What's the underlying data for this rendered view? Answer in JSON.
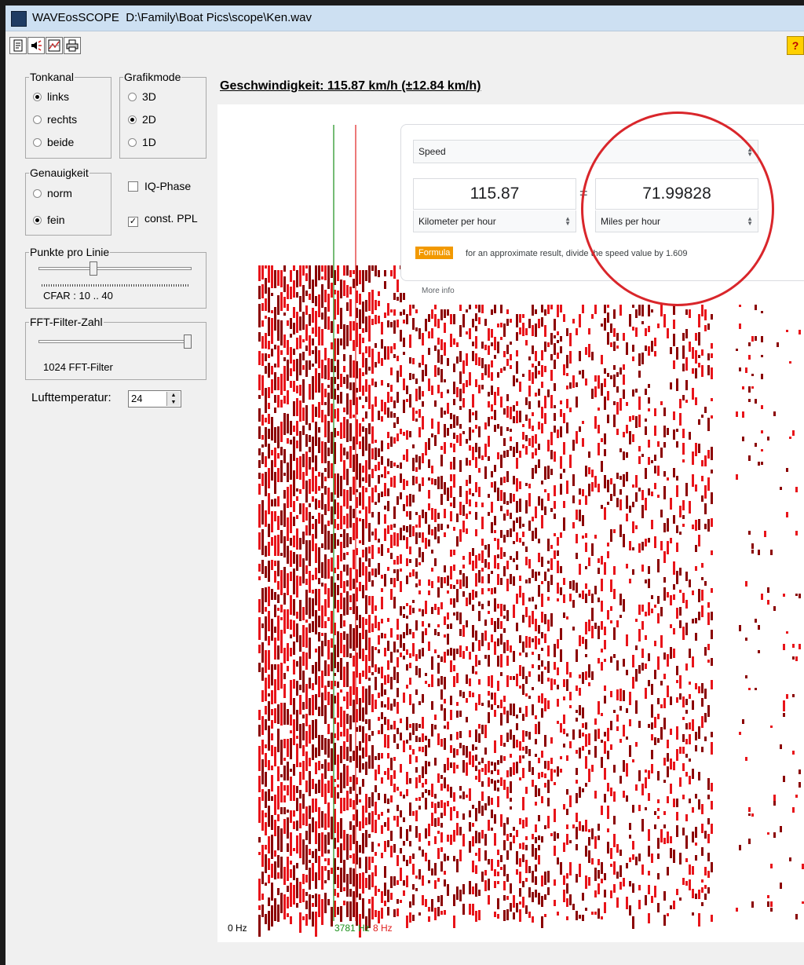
{
  "window": {
    "app_name": "WAVEosSCOPE",
    "file_path": "D:\\Family\\Boat Pics\\scope\\Ken.wav"
  },
  "toolbar": {
    "buttons": [
      {
        "icon": "document-icon"
      },
      {
        "icon": "speaker-icon"
      },
      {
        "icon": "chart-icon"
      },
      {
        "icon": "printer-icon"
      }
    ],
    "help_label": "?"
  },
  "controls": {
    "tonkanal": {
      "label": "Tonkanal",
      "options": [
        "links",
        "rechts",
        "beide"
      ],
      "selected": "links"
    },
    "grafikmode": {
      "label": "Grafikmode",
      "options": [
        "3D",
        "2D",
        "1D"
      ],
      "selected": "2D"
    },
    "genauigkeit": {
      "label": "Genauigkeit",
      "options": [
        "norm",
        "fein"
      ],
      "selected": "fein"
    },
    "iq_phase": {
      "label": "IQ-Phase",
      "checked": false
    },
    "const_ppl": {
      "label": "const. PPL",
      "checked": true,
      "mark": "✓"
    },
    "punkte_pro_linie": {
      "label": "Punkte pro Linie",
      "value_text": "CFAR : 10 .. 40",
      "level": 0.35
    },
    "fft_filter_zahl": {
      "label": "FFT-Filter-Zahl",
      "value_text": "1024 FFT-Filter",
      "level": 1.0
    },
    "lufttemperatur": {
      "label": "Lufttemperatur:",
      "value": "24"
    }
  },
  "main": {
    "speed_title": "Geschwindigkeit: 115.87 km/h (±12.84 km/h)",
    "axis": {
      "left_label": "0 Hz",
      "green_marker_label": "3781 Hz",
      "red_marker_label": "8 Hz",
      "green_color": "#1a8f1a",
      "red_color": "#e02020"
    }
  },
  "converter": {
    "category": "Speed",
    "from_value": "115.87",
    "to_value": "71.99828",
    "equals": "=",
    "from_unit": "Kilometer per hour",
    "to_unit": "Miles per hour",
    "formula_label": "Formula",
    "formula_text": "for an approximate result, divide the speed value by 1.609",
    "more_info": "More info",
    "highlight_color": "#d9262b"
  },
  "colors": {
    "spectrum_red": "#e8141a",
    "spectrum_dark": "#8b0000",
    "window_bg": "#f0f0f0",
    "title_bar": "#cde0f2"
  }
}
